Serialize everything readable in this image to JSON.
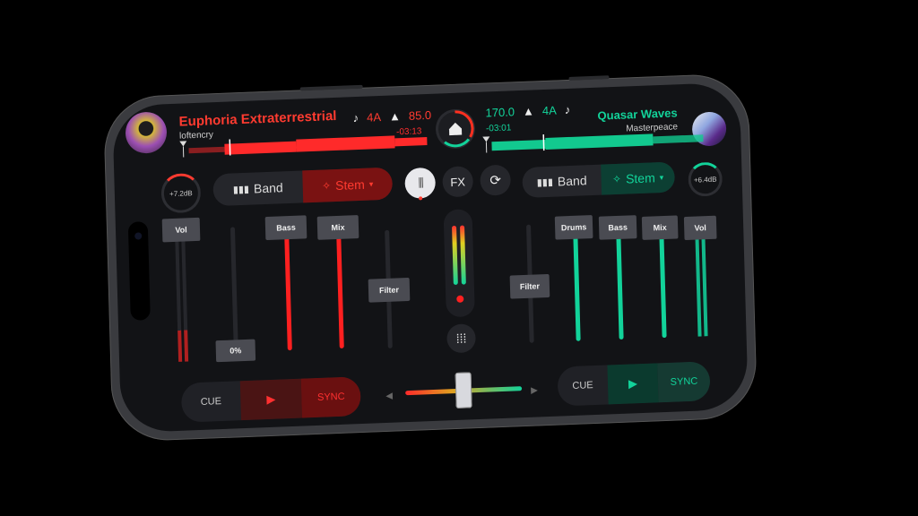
{
  "deck_a": {
    "title": "Euphoria Extraterrestrial",
    "artist": "loftencry",
    "key": "4A",
    "bpm": "85.0",
    "remaining": "-03:13",
    "gain": "+7.2dB",
    "band_label": "Band",
    "stem_label": "Stem",
    "faders": {
      "vol": "Vol",
      "bass": "Bass",
      "mix": "Mix",
      "filter": "Filter",
      "pitch_value": "0%"
    },
    "cue": "CUE",
    "sync": "SYNC",
    "accent": "#ff2020"
  },
  "deck_b": {
    "title": "Quasar Waves",
    "artist": "Masterpeace",
    "key": "4A",
    "bpm": "170.0",
    "remaining": "-03:01",
    "gain": "+6.4dB",
    "band_label": "Band",
    "stem_label": "Stem",
    "faders": {
      "drums": "Drums",
      "bass": "Bass",
      "mix": "Mix",
      "vol": "Vol",
      "filter": "Filter"
    },
    "cue": "CUE",
    "sync": "SYNC",
    "accent": "#12d39a"
  },
  "center": {
    "fx_label": "FX",
    "icons": [
      "home-icon",
      "mixer-sliders-icon",
      "loop-icon",
      "grid-icon",
      "music-note-icon",
      "metronome-icon"
    ],
    "crossfader_position": 0.5
  }
}
